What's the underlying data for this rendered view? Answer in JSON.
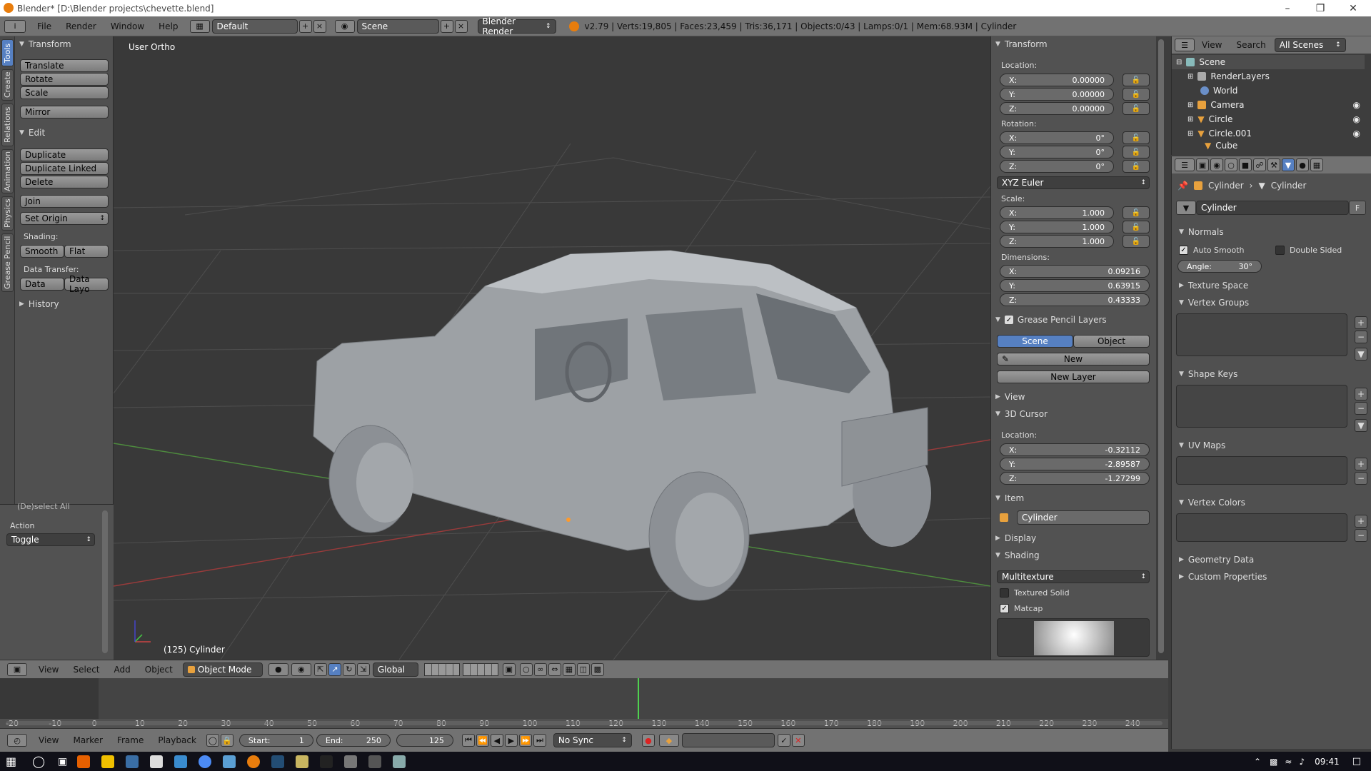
{
  "window": {
    "title": "Blender* [D:\\Blender projects\\chevette.blend]",
    "controls": [
      "minimize-icon",
      "restore-icon",
      "close-icon"
    ]
  },
  "info_bar": {
    "menus": [
      "File",
      "Render",
      "Window",
      "Help"
    ],
    "screen_layout": "Default",
    "scene": "Scene",
    "render_engine": "Blender Render",
    "stats": "v2.79 | Verts:19,805 | Faces:23,459 | Tris:36,171 | Objects:0/43 | Lamps:0/1 | Mem:68.93M | Cylinder"
  },
  "tool_shelf": {
    "tabs": [
      "Tools",
      "Create",
      "Relations",
      "Animation",
      "Physics",
      "Grease Pencil"
    ],
    "transform_header": "Transform",
    "transform_buttons": [
      "Translate",
      "Rotate",
      "Scale"
    ],
    "mirror": "Mirror",
    "edit_header": "Edit",
    "edit_buttons": [
      "Duplicate",
      "Duplicate Linked",
      "Delete"
    ],
    "join": "Join",
    "set_origin": "Set Origin",
    "shading_label": "Shading:",
    "smooth": "Smooth",
    "flat": "Flat",
    "data_transfer_label": "Data Transfer:",
    "data": "Data",
    "data_layo": "Data Layo",
    "history": "History"
  },
  "operator_panel": {
    "title": "(De)select All",
    "action_label": "Action",
    "action_value": "Toggle"
  },
  "viewport": {
    "view_name": "User Ortho",
    "object_label": "(125) Cylinder"
  },
  "properties_n": {
    "transform_header": "Transform",
    "location_label": "Location:",
    "location": [
      {
        "axis": "X:",
        "value": "0.00000"
      },
      {
        "axis": "Y:",
        "value": "0.00000"
      },
      {
        "axis": "Z:",
        "value": "0.00000"
      }
    ],
    "rotation_label": "Rotation:",
    "rotation": [
      {
        "axis": "X:",
        "value": "0°"
      },
      {
        "axis": "Y:",
        "value": "0°"
      },
      {
        "axis": "Z:",
        "value": "0°"
      }
    ],
    "rotation_mode": "XYZ Euler",
    "scale_label": "Scale:",
    "scale": [
      {
        "axis": "X:",
        "value": "1.000"
      },
      {
        "axis": "Y:",
        "value": "1.000"
      },
      {
        "axis": "Z:",
        "value": "1.000"
      }
    ],
    "dimensions_label": "Dimensions:",
    "dimensions": [
      {
        "axis": "X:",
        "value": "0.09216"
      },
      {
        "axis": "Y:",
        "value": "0.63915"
      },
      {
        "axis": "Z:",
        "value": "0.43333"
      }
    ],
    "grease_pencil_header": "Grease Pencil Layers",
    "gp_scene": "Scene",
    "gp_object": "Object",
    "gp_new": "New",
    "gp_new_layer": "New Layer",
    "view_header": "View",
    "cursor_header": "3D Cursor",
    "cursor_location_label": "Location:",
    "cursor": [
      {
        "axis": "X:",
        "value": "-0.32112"
      },
      {
        "axis": "Y:",
        "value": "-2.89587"
      },
      {
        "axis": "Z:",
        "value": "-1.27299"
      }
    ],
    "item_header": "Item",
    "item_name": "Cylinder",
    "display_header": "Display",
    "shading_header": "Shading",
    "shading_mode": "Multitexture",
    "textured_solid": "Textured Solid",
    "matcap": "Matcap"
  },
  "outliner": {
    "view": "View",
    "search": "Search",
    "filter": "All Scenes",
    "rows": [
      "Scene",
      "RenderLayers",
      "World",
      "Camera",
      "Circle",
      "Circle.001",
      "Cube"
    ]
  },
  "properties_editor": {
    "breadcrumb_object": "Cylinder",
    "breadcrumb_mesh": "Cylinder",
    "mesh_name": "Cylinder",
    "fake_user": "F",
    "normals_header": "Normals",
    "auto_smooth": "Auto Smooth",
    "double_sided": "Double Sided",
    "angle": "Angle:",
    "angle_value": "30°",
    "texture_space": "Texture Space",
    "vertex_groups": "Vertex Groups",
    "shape_keys": "Shape Keys",
    "uv_maps": "UV Maps",
    "vertex_colors": "Vertex Colors",
    "geometry_data": "Geometry Data",
    "custom_properties": "Custom Properties"
  },
  "view3d_header": {
    "menus": [
      "View",
      "Select",
      "Add",
      "Object"
    ],
    "mode": "Object Mode",
    "orientation": "Global"
  },
  "timeline": {
    "ticks": [
      "-20",
      "-10",
      "0",
      "10",
      "20",
      "30",
      "40",
      "50",
      "60",
      "70",
      "80",
      "90",
      "100",
      "110",
      "120",
      "130",
      "140",
      "150",
      "160",
      "170",
      "180",
      "190",
      "200",
      "210",
      "220",
      "230",
      "240"
    ],
    "menus": [
      "View",
      "Marker",
      "Frame",
      "Playback"
    ],
    "start_label": "Start:",
    "start_value": "1",
    "end_label": "End:",
    "end_value": "250",
    "current_frame": "125",
    "sync": "No Sync"
  },
  "taskbar": {
    "time": "09:41"
  }
}
